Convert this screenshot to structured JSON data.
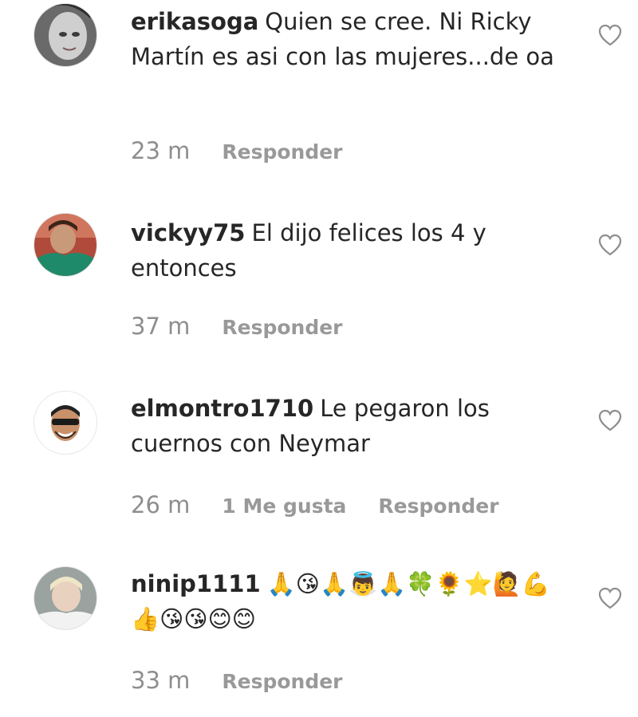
{
  "comments": [
    {
      "username": "erikasoga",
      "text": "Quien se cree. Ni Ricky Martín es asi con las mujeres...de oa",
      "time": "23 m",
      "likes": "",
      "reply": "Responder"
    },
    {
      "username": "vickyy75",
      "text": "El dijo felices los 4 y entonces",
      "time": "37 m",
      "likes": "",
      "reply": "Responder"
    },
    {
      "username": "elmontro1710",
      "text": "Le pegaron los cuernos con Neymar",
      "time": "26 m",
      "likes": "1 Me gusta",
      "reply": "Responder"
    },
    {
      "username": "ninip1111",
      "text": "🙏😘🙏👼🙏🍀🌻⭐🙋💪👍😘😘😊😊",
      "time": "33 m",
      "likes": "",
      "reply": "Responder"
    }
  ],
  "colors": {
    "text": "#262626",
    "muted": "#8e8e8e",
    "heart": "#8e8e8e"
  },
  "icons": {
    "avatar": "user-avatar",
    "like": "heart-outline-icon"
  }
}
